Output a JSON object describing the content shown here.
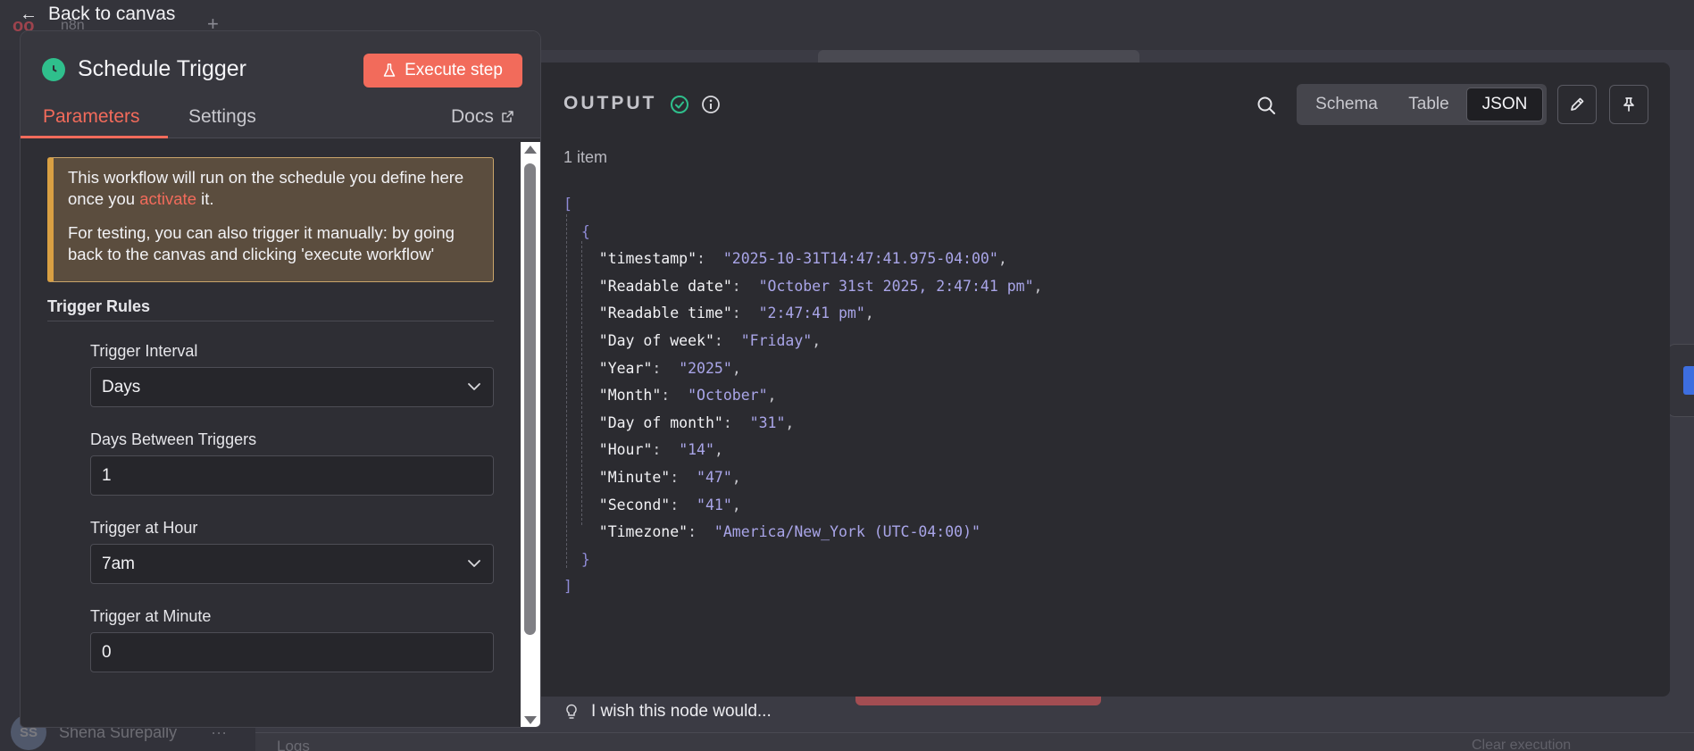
{
  "background": {
    "logo": "oo",
    "workflow_name": "n8n",
    "plus": "+",
    "user_initials": "SS",
    "user_name": "Shena Surepally",
    "user_menu": "···",
    "logs_label": "Logs",
    "clear_label": "Clear execution"
  },
  "back_link": {
    "label": "Back to canvas",
    "arrow": "←"
  },
  "node": {
    "title": "Schedule Trigger",
    "icon": "clock-icon",
    "icon_color": "#2fbf8c",
    "execute_label": "Execute step",
    "execute_color": "#f26b5b"
  },
  "tabs": {
    "parameters": "Parameters",
    "settings": "Settings",
    "docs": "Docs"
  },
  "notice": {
    "text1_before": "This workflow will run on the schedule you define here once you ",
    "text1_link": "activate",
    "text1_after": " it.",
    "text2": "For testing, you can also trigger it manually: by going back to the canvas and clicking 'execute workflow'"
  },
  "trigger_rules": {
    "title": "Trigger Rules",
    "fields": [
      {
        "label": "Trigger Interval",
        "value": "Days",
        "type": "select"
      },
      {
        "label": "Days Between Triggers",
        "value": "1",
        "type": "input"
      },
      {
        "label": "Trigger at Hour",
        "value": "7am",
        "type": "select"
      },
      {
        "label": "Trigger at Minute",
        "value": "0",
        "type": "input"
      }
    ]
  },
  "output": {
    "title": "OUTPUT",
    "item_count": "1 item",
    "views": [
      "Schema",
      "Table",
      "JSON"
    ],
    "active_view": "JSON",
    "json": [
      {
        "key": "timestamp",
        "value": "2025-10-31T14:47:41.975-04:00"
      },
      {
        "key": "Readable date",
        "value": "October 31st 2025, 2:47:41 pm"
      },
      {
        "key": "Readable time",
        "value": "2:47:41 pm"
      },
      {
        "key": "Day of week",
        "value": "Friday"
      },
      {
        "key": "Year",
        "value": "2025"
      },
      {
        "key": "Month",
        "value": "October"
      },
      {
        "key": "Day of month",
        "value": "31"
      },
      {
        "key": "Hour",
        "value": "14"
      },
      {
        "key": "Minute",
        "value": "47"
      },
      {
        "key": "Second",
        "value": "41"
      },
      {
        "key": "Timezone",
        "value": "America/New_York (UTC-04:00)"
      }
    ]
  },
  "feedback": {
    "label": "I wish this node would..."
  }
}
